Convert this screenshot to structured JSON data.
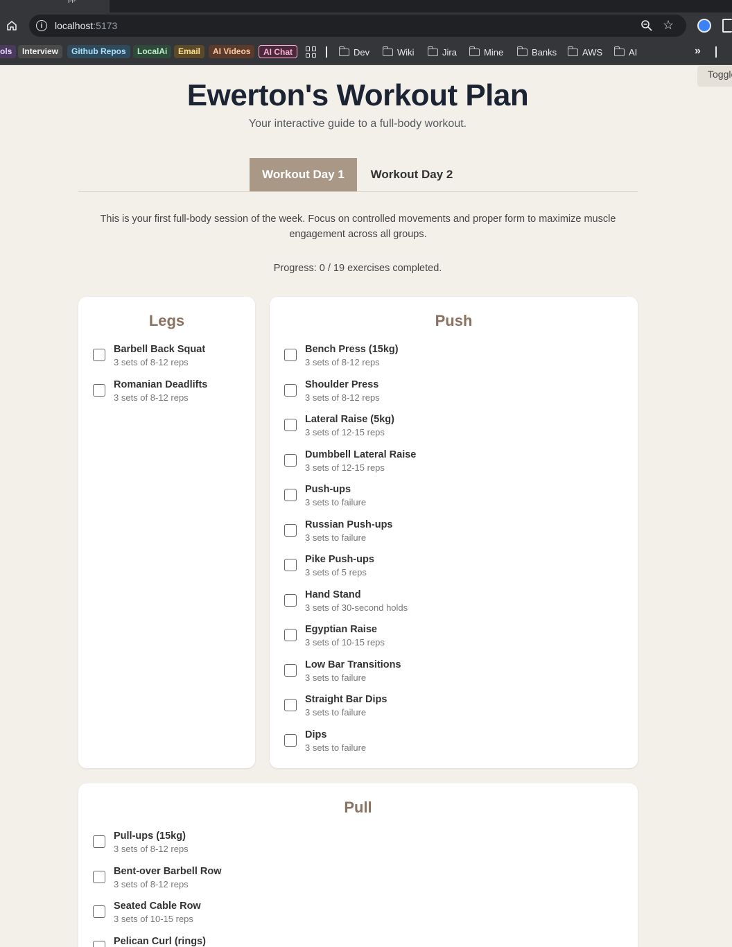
{
  "browser": {
    "tab_title_fragment": "pp",
    "url_host": "localhost",
    "url_port": ":5173",
    "bookmarks_chips": [
      {
        "label": "ols",
        "bg": "#4b3a5e",
        "fg": "#e6d6ff"
      },
      {
        "label": "Interview",
        "bg": "#4a4a4a",
        "fg": "#f0f0f0"
      },
      {
        "label": "Github Repos",
        "bg": "#2f4a5a",
        "fg": "#a9e1ff"
      },
      {
        "label": "LocalAi",
        "bg": "#2f4a3a",
        "fg": "#b5f0c8"
      },
      {
        "label": "Email",
        "bg": "#5a4a2a",
        "fg": "#ffe08a"
      },
      {
        "label": "AI Videos",
        "bg": "#5a3a2a",
        "fg": "#ffc9a3"
      },
      {
        "label": "AI Chat",
        "bg": "#4a2a3a",
        "fg": "#ffb3d9"
      }
    ],
    "bookmark_folders": [
      "Dev",
      "Wiki",
      "Jira",
      "Mine",
      "Banks",
      "AWS",
      "AI"
    ]
  },
  "page": {
    "toggle_label": "Toggle",
    "title": "Ewerton's Workout Plan",
    "subtitle": "Your interactive guide to a full-body workout.",
    "tabs": [
      {
        "label": "Workout Day 1",
        "active": true
      },
      {
        "label": "Workout Day 2",
        "active": false
      }
    ],
    "intro": "This is your first full-body session of the week. Focus on controlled movements and proper form to maximize muscle engagement across all groups.",
    "progress": "Progress: 0 / 19 exercises completed."
  },
  "groups": {
    "legs": {
      "title": "Legs",
      "exercises": [
        {
          "name": "Barbell Back Squat",
          "detail": "3 sets of 8-12 reps"
        },
        {
          "name": "Romanian Deadlifts",
          "detail": "3 sets of 8-12 reps"
        }
      ]
    },
    "push": {
      "title": "Push",
      "exercises": [
        {
          "name": "Bench Press (15kg)",
          "detail": "3 sets of 8-12 reps"
        },
        {
          "name": "Shoulder Press",
          "detail": "3 sets of 8-12 reps"
        },
        {
          "name": "Lateral Raise (5kg)",
          "detail": "3 sets of 12-15 reps"
        },
        {
          "name": "Dumbbell Lateral Raise",
          "detail": "3 sets of 12-15 reps"
        },
        {
          "name": "Push-ups",
          "detail": "3 sets to failure"
        },
        {
          "name": "Russian Push-ups",
          "detail": "3 sets to failure"
        },
        {
          "name": "Pike Push-ups",
          "detail": "3 sets of 5 reps"
        },
        {
          "name": "Hand Stand",
          "detail": "3 sets of 30-second holds"
        },
        {
          "name": "Egyptian Raise",
          "detail": "3 sets of 10-15 reps"
        },
        {
          "name": "Low Bar Transitions",
          "detail": "3 sets to failure"
        },
        {
          "name": "Straight Bar Dips",
          "detail": "3 sets to failure"
        },
        {
          "name": "Dips",
          "detail": "3 sets to failure"
        }
      ]
    },
    "pull": {
      "title": "Pull",
      "exercises": [
        {
          "name": "Pull-ups (15kg)",
          "detail": "3 sets of 8-12 reps"
        },
        {
          "name": "Bent-over Barbell Row",
          "detail": "3 sets of 8-12 reps"
        },
        {
          "name": "Seated Cable Row",
          "detail": "3 sets of 10-15 reps"
        },
        {
          "name": "Pelican Curl (rings)",
          "detail": ""
        }
      ]
    }
  }
}
